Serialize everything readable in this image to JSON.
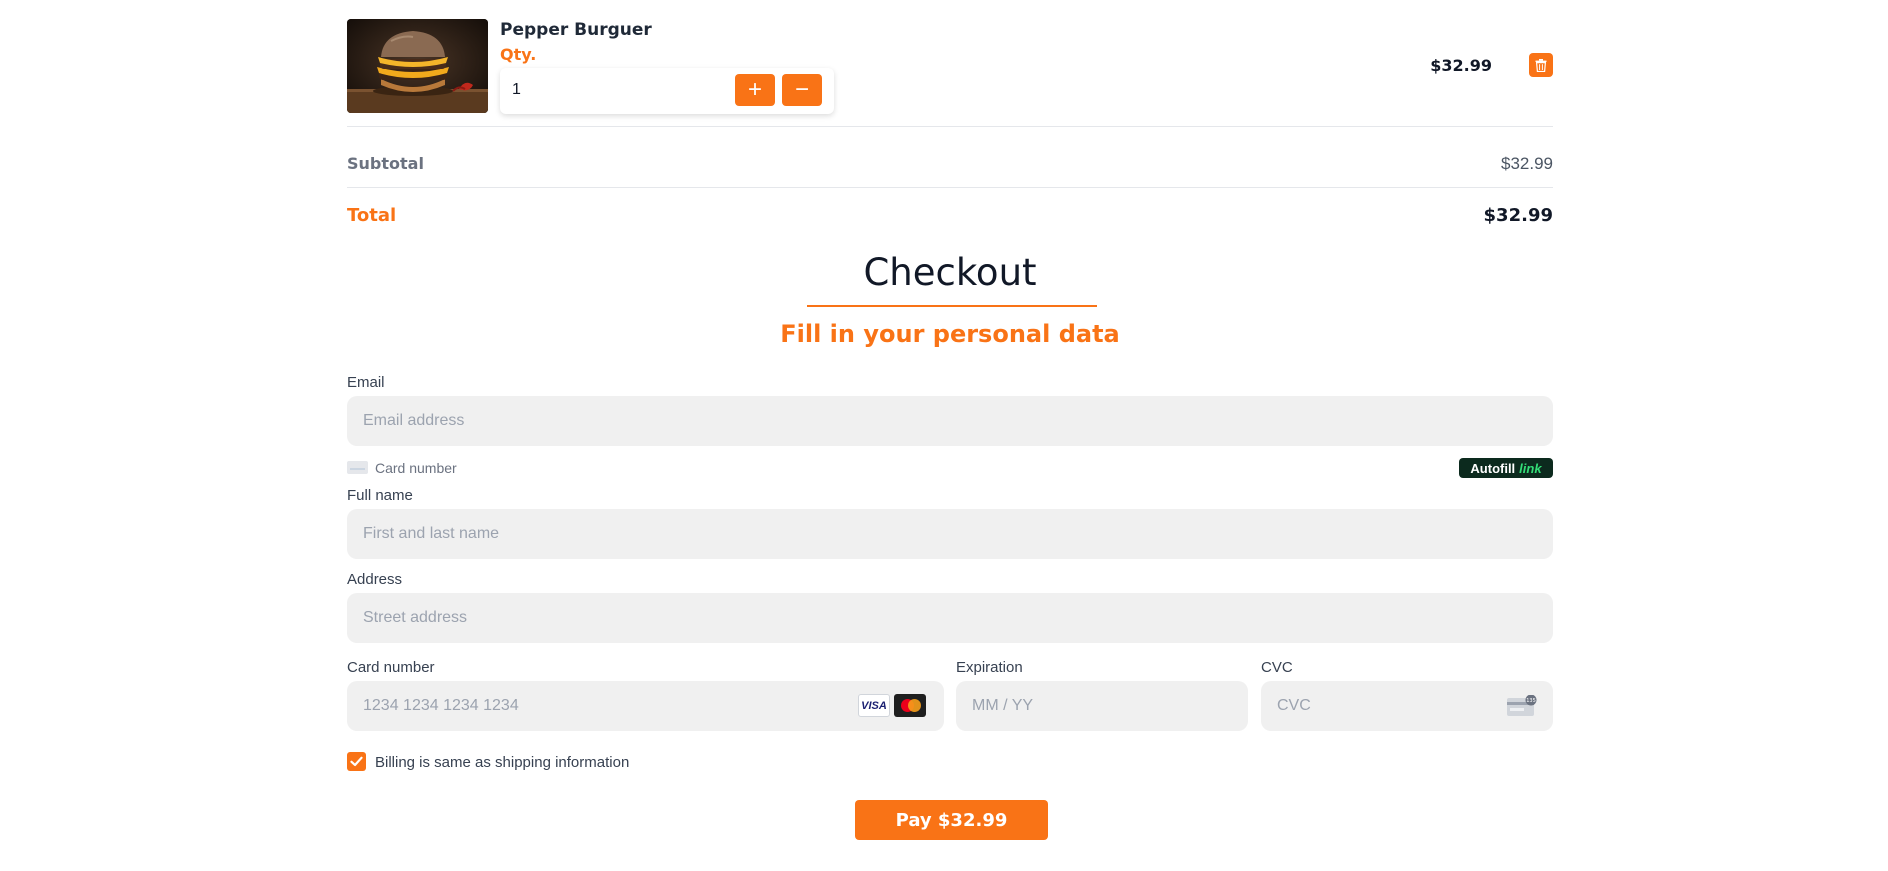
{
  "cart": {
    "item": {
      "name": "Pepper Burguer",
      "qty_label": "Qty.",
      "qty_value": "1",
      "plus_label": "+",
      "minus_label": "−",
      "price": "$32.99",
      "image_icon": "burger-photo",
      "trash_icon": "trash-icon"
    },
    "subtotal_label": "Subtotal",
    "subtotal_value": "$32.99",
    "total_label": "Total",
    "total_value": "$32.99"
  },
  "checkout": {
    "title": "Checkout",
    "subtitle": "Fill in your personal data",
    "email": {
      "label": "Email",
      "placeholder": "Email address"
    },
    "link_row": {
      "card_text": "Card number",
      "autofill_text": "Autofill",
      "autofill_link": "link"
    },
    "full_name": {
      "label": "Full name",
      "placeholder": "First and last name"
    },
    "address": {
      "label": "Address",
      "placeholder": "Street address"
    },
    "card_number": {
      "label": "Card number",
      "placeholder": "1234 1234 1234 1234",
      "brands": [
        "VISA",
        "mastercard"
      ]
    },
    "expiration": {
      "label": "Expiration",
      "placeholder": "MM / YY"
    },
    "cvc": {
      "label": "CVC",
      "placeholder": "CVC",
      "icon_badge": "135"
    },
    "billing_same": {
      "label": "Billing is same as shipping information",
      "checked": true
    },
    "pay_button": "Pay $32.99"
  },
  "colors": {
    "accent": "#f97316",
    "field_bg": "#f0f0f0",
    "link_bg": "#0c2a1e",
    "link_green": "#33dd77"
  }
}
